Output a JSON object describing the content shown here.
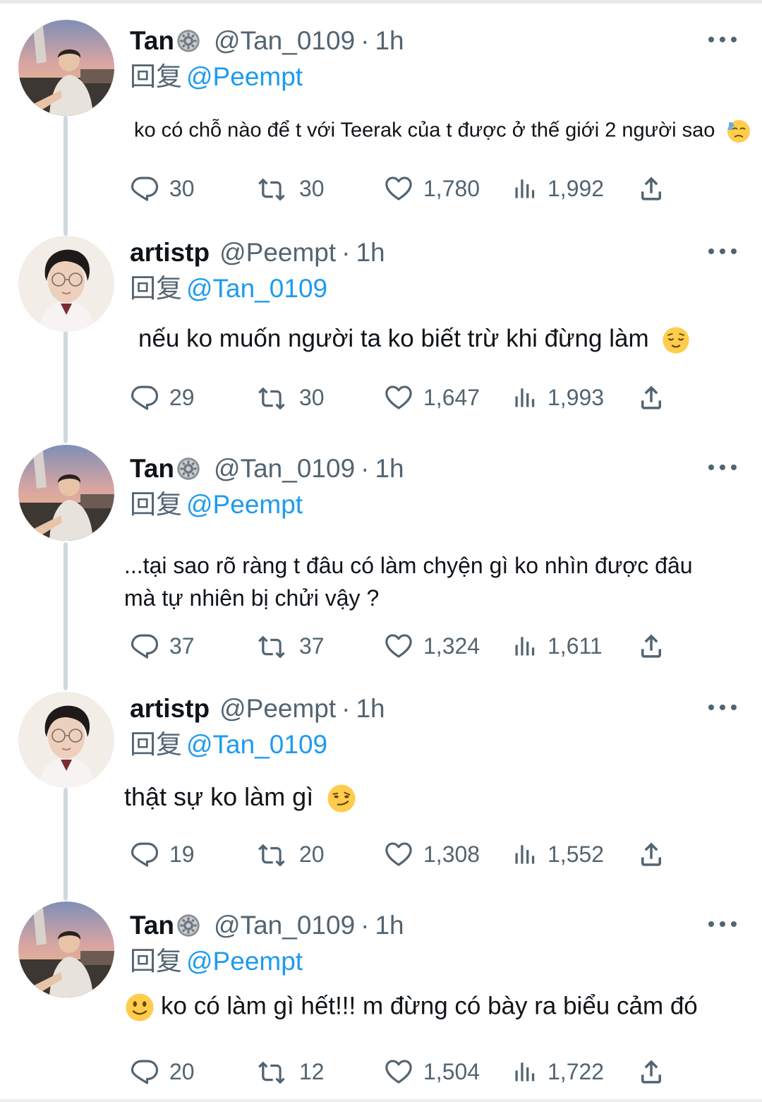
{
  "reply_prefix": "回复",
  "tweets": [
    {
      "name": "Tan",
      "handle": "@Tan_0109",
      "separator": "·",
      "time": "1h",
      "reply_to": "@Peempt",
      "text": "ko có chỗ nào để t với Teerak của t được ở thế giới 2 người sao",
      "emoji": "downcast-face-with-sweat",
      "stats": {
        "replies": "30",
        "retweets": "30",
        "likes": "1,780",
        "views": "1,992"
      }
    },
    {
      "name": "artistp",
      "handle": "@Peempt",
      "separator": "·",
      "time": "1h",
      "reply_to": "@Tan_0109",
      "text": "nếu ko muốn người ta ko biết trừ khi đừng làm",
      "emoji": "relieved-face",
      "stats": {
        "replies": "29",
        "retweets": "30",
        "likes": "1,647",
        "views": "1,993"
      }
    },
    {
      "name": "Tan",
      "handle": "@Tan_0109",
      "separator": "·",
      "time": "1h",
      "reply_to": "@Peempt",
      "text_line1": "...tại sao rõ ràng t đâu có làm chyện gì  ko nhìn được đâu",
      "text_line2": "mà tự nhiên bị chửi vậy ?",
      "stats": {
        "replies": "37",
        "retweets": "37",
        "likes": "1,324",
        "views": "1,611"
      }
    },
    {
      "name": "artistp",
      "handle": "@Peempt",
      "separator": "·",
      "time": "1h",
      "reply_to": "@Tan_0109",
      "text": "thật sự ko làm gì",
      "emoji": "smirking-face",
      "stats": {
        "replies": "19",
        "retweets": "20",
        "likes": "1,308",
        "views": "1,552"
      }
    },
    {
      "name": "Tan",
      "handle": "@Tan_0109",
      "separator": "·",
      "time": "1h",
      "reply_to": "@Peempt",
      "text": "ko có làm gì hết!!! m đừng có bày ra biểu cảm đó",
      "emoji": "slightly-smiling-face",
      "stats": {
        "replies": "20",
        "retweets": "12",
        "likes": "1,504",
        "views": "1,722"
      }
    }
  ],
  "colors": {
    "link": "#1d9bf0",
    "secondary_text": "#536471",
    "primary_text": "#0f1419",
    "thread_line": "#cfd9de"
  },
  "icons": [
    "reply-icon",
    "retweet-icon",
    "like-icon",
    "views-icon",
    "share-icon",
    "more-icon",
    "settings-badge-icon"
  ]
}
